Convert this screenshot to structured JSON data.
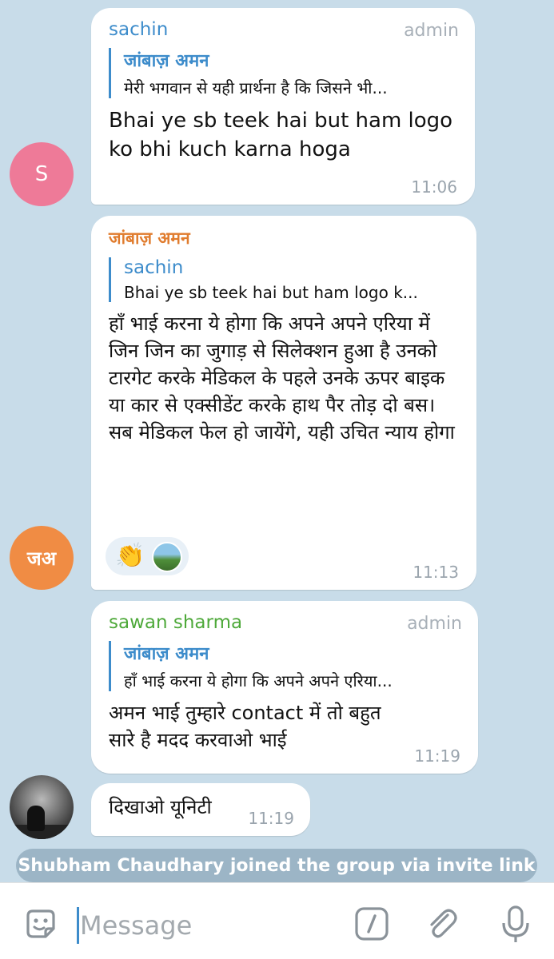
{
  "messages": [
    {
      "sender": "sachin",
      "badge": "admin",
      "reply_name": "जांबाज़ अमन",
      "reply_text": "मेरी भगवान से यही प्रार्थना है कि जिसने भी...",
      "text": "Bhai ye sb teek hai but ham logo ko bhi kuch karna hoga",
      "time": "11:06",
      "avatar": "S"
    },
    {
      "sender": "जांबाज़ अमन",
      "reply_name": "sachin",
      "reply_text": "Bhai ye sb teek hai but ham logo k...",
      "text": "हाँ भाई करना ये होगा कि अपने अपने एरिया में जिन जिन का जुगाड़ से सिलेक्शन हुआ है उनको टारगेट करके मेडिकल के पहले उनके ऊपर बाइक या कार से एक्सीडेंट करके हाथ पैर तोड़ दो बस। सब मेडिकल फेल हो जायेंगे, यही उचित न्याय होगा",
      "time": "11:13",
      "avatar": "जअ",
      "reactions": [
        "👏",
        "user-avatar"
      ]
    },
    {
      "sender": "sawan sharma",
      "badge": "admin",
      "reply_name": "जांबाज़ अमन",
      "reply_text": "हाँ भाई करना ये होगा कि अपने अपने एरिया...",
      "text": "अमन भाई तुम्हारे contact में तो बहुत सारे है मदद करवाओ भाई",
      "time": "11:19"
    },
    {
      "text": "दिखाओ यूनिटी",
      "time": "11:19",
      "avatar": "photo"
    }
  ],
  "system_message": "Shubham Chaudhary joined the group via invite link",
  "input": {
    "placeholder": "Message",
    "icons": [
      "sticker-icon",
      "bot-command-icon",
      "attach-icon",
      "mic-icon"
    ]
  },
  "colors": {
    "background": "#c8dce9",
    "link_blue": "#3d8ccb",
    "orange_name": "#e07c2e",
    "green_name": "#4ea93a"
  }
}
